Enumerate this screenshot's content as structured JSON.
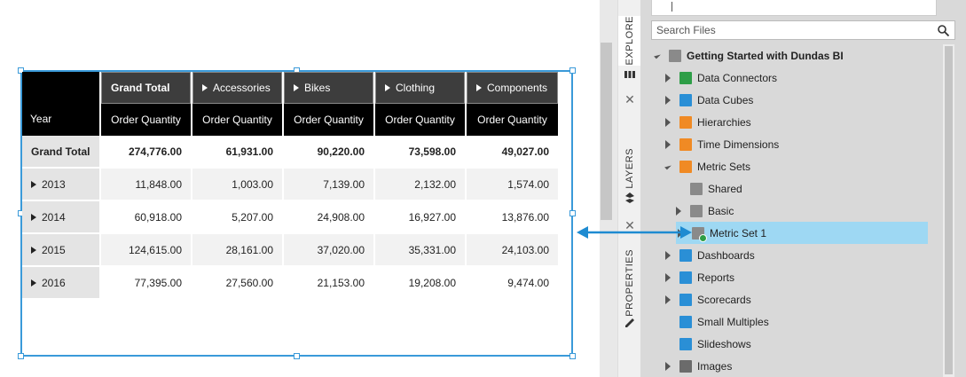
{
  "table": {
    "row_header_label": "Year",
    "columns": [
      {
        "label": "Grand Total",
        "measure": "Order Quantity",
        "expandable": false
      },
      {
        "label": "Accessories",
        "measure": "Order Quantity",
        "expandable": true
      },
      {
        "label": "Bikes",
        "measure": "Order Quantity",
        "expandable": true
      },
      {
        "label": "Clothing",
        "measure": "Order Quantity",
        "expandable": true
      },
      {
        "label": "Components",
        "measure": "Order Quantity",
        "expandable": true
      }
    ],
    "rows": [
      {
        "label": "Grand Total",
        "bold": true,
        "values": [
          "274,776.00",
          "61,931.00",
          "90,220.00",
          "73,598.00",
          "49,027.00"
        ]
      },
      {
        "label": "2013",
        "bold": false,
        "values": [
          "11,848.00",
          "1,003.00",
          "7,139.00",
          "2,132.00",
          "1,574.00"
        ]
      },
      {
        "label": "2014",
        "bold": false,
        "values": [
          "60,918.00",
          "5,207.00",
          "24,908.00",
          "16,927.00",
          "13,876.00"
        ]
      },
      {
        "label": "2015",
        "bold": false,
        "values": [
          "124,615.00",
          "28,161.00",
          "37,020.00",
          "35,331.00",
          "24,103.00"
        ]
      },
      {
        "label": "2016",
        "bold": false,
        "values": [
          "77,395.00",
          "27,560.00",
          "21,153.00",
          "19,208.00",
          "9,474.00"
        ]
      }
    ]
  },
  "side_tabs": {
    "explore": "EXPLORE",
    "layers": "LAYERS",
    "properties": "PROPERTIES"
  },
  "panel": {
    "search_placeholder": "Search Files",
    "tree": [
      {
        "label": "Getting Started with Dundas BI",
        "level": 0,
        "state": "open",
        "icon": "project-icon",
        "bold": true
      },
      {
        "label": "Data Connectors",
        "level": 1,
        "state": "closed",
        "icon": "data-connector-icon"
      },
      {
        "label": "Data Cubes",
        "level": 1,
        "state": "closed",
        "icon": "data-cube-icon"
      },
      {
        "label": "Hierarchies",
        "level": 1,
        "state": "closed",
        "icon": "hierarchy-icon"
      },
      {
        "label": "Time Dimensions",
        "level": 1,
        "state": "closed",
        "icon": "time-dimension-icon"
      },
      {
        "label": "Metric Sets",
        "level": 1,
        "state": "open",
        "icon": "metric-sets-icon"
      },
      {
        "label": "Shared",
        "level": 2,
        "state": "none",
        "icon": "shared-folder-icon"
      },
      {
        "label": "Basic",
        "level": 2,
        "state": "closed",
        "icon": "basic-folder-icon"
      },
      {
        "label": "Metric Set 1",
        "level": 2,
        "state": "closed",
        "icon": "metric-set-icon",
        "selected": true
      },
      {
        "label": "Dashboards",
        "level": 1,
        "state": "closed",
        "icon": "dashboard-icon"
      },
      {
        "label": "Reports",
        "level": 1,
        "state": "closed",
        "icon": "report-icon"
      },
      {
        "label": "Scorecards",
        "level": 1,
        "state": "closed",
        "icon": "scorecard-icon"
      },
      {
        "label": "Small Multiples",
        "level": 1,
        "state": "none",
        "icon": "small-multiples-icon"
      },
      {
        "label": "Slideshows",
        "level": 1,
        "state": "none",
        "icon": "slideshow-icon"
      },
      {
        "label": "Images",
        "level": 1,
        "state": "closed",
        "icon": "images-icon"
      }
    ]
  },
  "colors": {
    "selection": "#3a9ad9",
    "tree_selected": "#9ed8f3",
    "header_black": "#000000",
    "header_dark": "#3d3d3d",
    "icon_green": "#2e9e47",
    "icon_blue": "#2a8fd6",
    "icon_orange": "#f08a24",
    "icon_gray": "#8a8a8a"
  }
}
